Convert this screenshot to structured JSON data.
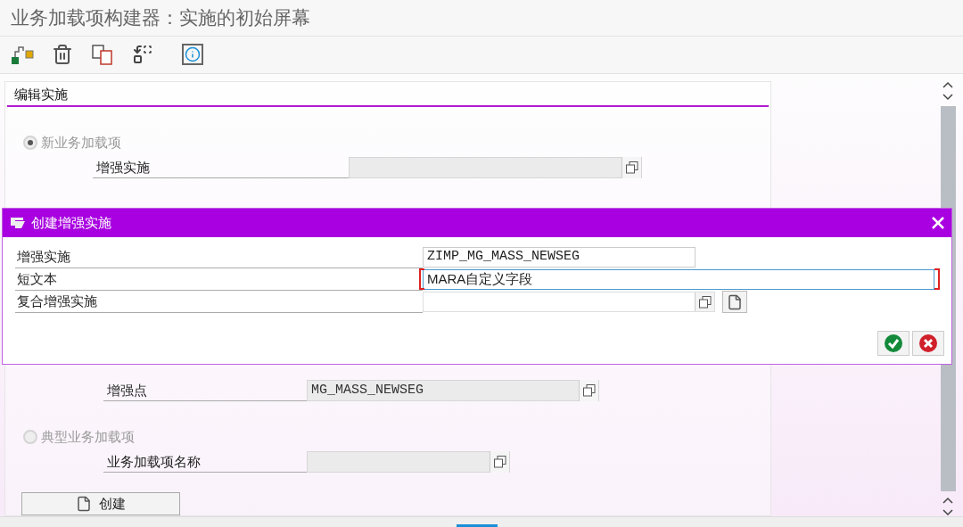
{
  "window": {
    "title": "业务加载项构建器：实施的初始屏幕"
  },
  "panel": {
    "title": "编辑实施",
    "upper": {
      "radio": {
        "label": "新业务加载项",
        "selected": true
      },
      "field": {
        "label": "增强实施"
      }
    },
    "lower": {
      "field": {
        "label": "增强点",
        "value": "MG_MASS_NEWSEG"
      },
      "radio": {
        "label": "典型业务加载项",
        "selected": false
      },
      "field_2": {
        "label": "业务加载项名称"
      }
    },
    "create_button": {
      "label": "创建"
    }
  },
  "dialog": {
    "title": "创建增强实施",
    "fields": [
      {
        "label": "增强实施",
        "value": "ZIMP_MG_MASS_NEWSEG",
        "kind": "mono",
        "focused": false
      },
      {
        "label": "短文本",
        "value": "MARA自定义字段",
        "kind": "text",
        "focused": true
      },
      {
        "label": "复合增强实施",
        "kind": "help",
        "focused": false
      }
    ]
  }
}
